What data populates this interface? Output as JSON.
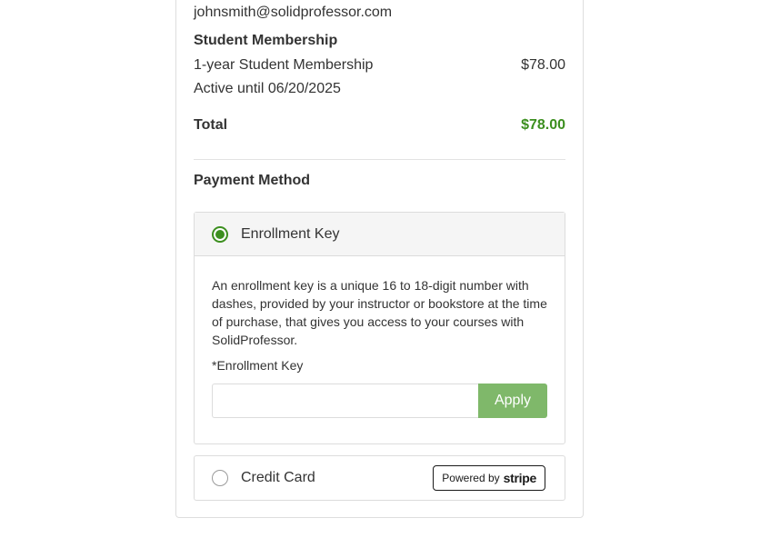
{
  "account": {
    "email": "johnsmith@solidprofessor.com"
  },
  "order": {
    "section_title": "Student Membership",
    "item_name": "1-year Student Membership",
    "item_price": "$78.00",
    "active_until": "Active until 06/20/2025",
    "total_label": "Total",
    "total_amount": "$78.00"
  },
  "payment": {
    "title": "Payment Method",
    "options": [
      {
        "label": "Enrollment Key",
        "selected": true,
        "description": "An enrollment key is a unique 16 to 18-digit number with dashes, provided by your instructor or bookstore at the time of purchase, that gives you access to your courses with SolidProfessor.",
        "field_label": "*Enrollment Key",
        "field_value": "",
        "apply_label": "Apply"
      },
      {
        "label": "Credit Card",
        "selected": false,
        "badge_prefix": "Powered by",
        "badge_brand": "stripe"
      }
    ]
  },
  "colors": {
    "accent": "#3c8f1f",
    "apply_button": "#7fb86a"
  }
}
